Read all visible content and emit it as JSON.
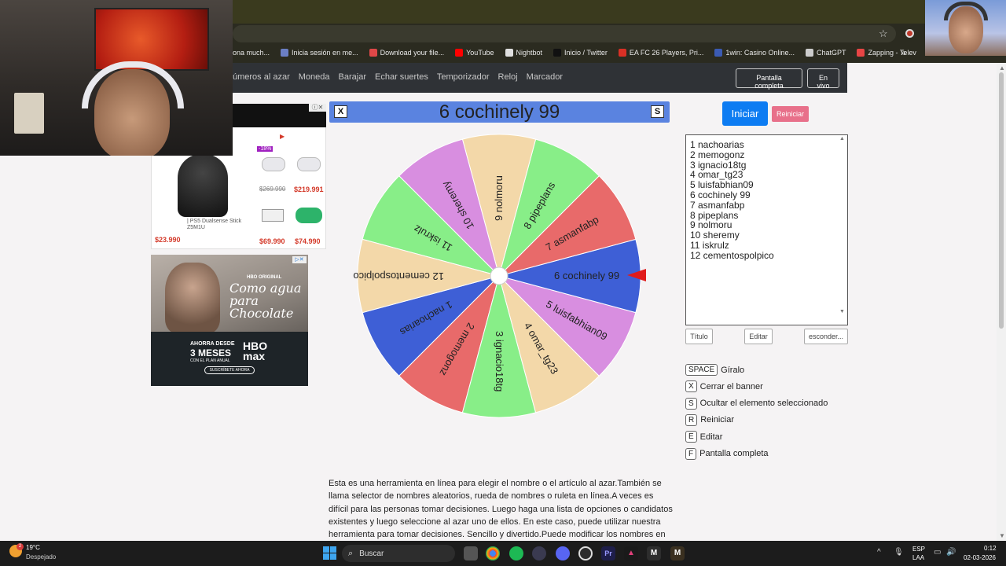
{
  "browser": {
    "bookmarks": [
      {
        "label": "ona much...",
        "color": "#444"
      },
      {
        "label": "Inicia sesión en me...",
        "color": "#6b7fc4"
      },
      {
        "label": "Download your file...",
        "color": "#e04848"
      },
      {
        "label": "YouTube",
        "color": "#ff0000"
      },
      {
        "label": "Nightbot",
        "color": "#e0e0e0"
      },
      {
        "label": "Inicio / Twitter",
        "color": "#111"
      },
      {
        "label": "EA FC 26 Players, Pri...",
        "color": "#d93025"
      },
      {
        "label": "1win: Casino Online...",
        "color": "#3b5bb3"
      },
      {
        "label": "ChatGPT",
        "color": "#ccc"
      },
      {
        "label": "Zapping - Televisión...",
        "color": "#e84545"
      }
    ]
  },
  "nav": {
    "links": [
      "úmeros al azar",
      "Moneda",
      "Barajar",
      "Echar suertes",
      "Temporizador",
      "Reloj",
      "Marcador"
    ],
    "fullscreen": "Pantalla completa",
    "live": "En vivo"
  },
  "ad1": {
    "products": [
      {
        "name": "| PS5 Dualsense Stick Z5M1U",
        "price": "$23.990",
        "old": ""
      },
      {
        "name": "",
        "price": "$219.991",
        "old": "$269.990",
        "badge": "-18%"
      },
      {
        "name": "",
        "price": "$69.990",
        "old": ""
      },
      {
        "name": "",
        "price": "$74.990",
        "old": ""
      }
    ]
  },
  "ad2": {
    "brand": "HBO ORIGINAL",
    "title": "Como agua para Chocolate",
    "line1": "AHORRA DESDE",
    "line2": "3 MESES",
    "line3": "CON EL PLAN ANUAL",
    "logo": "HBO max",
    "cta": "SUSCRÍBETE AHORA"
  },
  "wheel": {
    "selected": "6 cochinely 99",
    "close_key": "X",
    "hide_key": "S",
    "segments": [
      {
        "label": "1 nachoarias",
        "color": "#3e5fd6"
      },
      {
        "label": "2 memogonz",
        "color": "#e86a6a"
      },
      {
        "label": "3 ignacio18tg",
        "color": "#88ee88"
      },
      {
        "label": "4 omar_tg23",
        "color": "#f3d8a9"
      },
      {
        "label": "5 luisfabhian09",
        "color": "#d88ee0"
      },
      {
        "label": "6 cochinely 99",
        "color": "#3e5fd6"
      },
      {
        "label": "7 asmanfabp",
        "color": "#e86a6a"
      },
      {
        "label": "8 pipeplans",
        "color": "#88ee88"
      },
      {
        "label": "9 nolmoru",
        "color": "#f3d8a9"
      },
      {
        "label": "10 sheremy",
        "color": "#d88ee0"
      },
      {
        "label": "11 iskrulz",
        "color": "#88ee88"
      },
      {
        "label": "12 cementospolpico",
        "color": "#f3d8a9"
      }
    ],
    "pointer_color": "#e01b1b"
  },
  "panel": {
    "start": "Iniciar",
    "reset": "Reiniciar",
    "names": [
      "1 nachoarias",
      "2 memogonz",
      "3 ignacio18tg",
      "4 omar_tg23",
      "5 luisfabhian09",
      "6 cochinely 99",
      "7 asmanfabp",
      "8 pipeplans",
      "9 nolmoru",
      "10 sheremy",
      "11 iskrulz",
      "12 cementospolpico"
    ],
    "title_btn": "Título",
    "edit_btn": "Editar",
    "hide_btn": "esconder...",
    "shortcuts": [
      {
        "key": "SPACE",
        "label": "Gíralo"
      },
      {
        "key": "X",
        "label": "Cerrar el banner"
      },
      {
        "key": "S",
        "label": "Ocultar el elemento seleccionado"
      },
      {
        "key": "R",
        "label": "Reiniciar"
      },
      {
        "key": "E",
        "label": "Editar"
      },
      {
        "key": "F",
        "label": "Pantalla completa"
      }
    ]
  },
  "description": "Esta es una herramienta en línea para elegir el nombre o el artículo al azar.También se llama selector de nombres aleatorios, rueda de nombres o ruleta en línea.A veces es difícil para las personas tomar decisiones. Luego haga una lista de opciones o candidatos existentes y luego seleccione al azar uno de ellos. En este caso, puede utilizar nuestra herramienta para tomar decisiones. Sencillo y divertido.Puede modificar los nombres en textarea, poner un",
  "taskbar": {
    "weather_temp": "19°C",
    "weather_desc": "Despejado",
    "weather_badge": "2",
    "search": "Buscar",
    "lang1": "ESP",
    "lang2": "LAA",
    "time": "0:12",
    "date": "02-03-2026"
  }
}
